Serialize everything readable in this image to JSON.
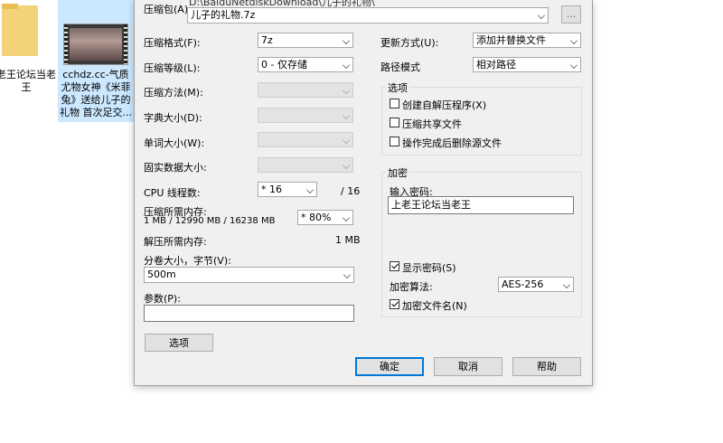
{
  "explorer": {
    "items": [
      {
        "label": "老王论坛当老\n王",
        "icon": "folder-icon"
      },
      {
        "label": "cchdz.cc-气质尤物女神《米菲兔》送给儿子的礼物 首次足交...",
        "icon": "video-thumbnail-icon"
      }
    ]
  },
  "dialog": {
    "archive": {
      "label": "压缩包(A)",
      "path_value": "D:\\BaiduNetdiskDownload\\儿子的礼物\\",
      "name_value": "儿子的礼物.7z",
      "browse_label": "..."
    },
    "left": {
      "format": {
        "label": "压缩格式(F):",
        "value": "7z"
      },
      "level": {
        "label": "压缩等级(L):",
        "value": "0 - 仅存储"
      },
      "method": {
        "label": "压缩方法(M):",
        "value": ""
      },
      "dict": {
        "label": "字典大小(D):",
        "value": ""
      },
      "word": {
        "label": "单词大小(W):",
        "value": ""
      },
      "solid": {
        "label": "固实数据大小:",
        "value": ""
      },
      "threads": {
        "label": "CPU 线程数:",
        "value": "* 16",
        "max": "/ 16"
      },
      "mem_comp": {
        "label": "压缩所需内存:",
        "detail": "1 MB / 12990 MB / 16238 MB",
        "value": "* 80%"
      },
      "mem_decomp": {
        "label": "解压所需内存:",
        "value": "1 MB"
      },
      "volume": {
        "label": "分卷大小，字节(V):",
        "value": "500m"
      },
      "params": {
        "label": "参数(P):",
        "value": ""
      },
      "options_button": "选项"
    },
    "right": {
      "update_mode": {
        "label": "更新方式(U):",
        "value": "添加并替换文件"
      },
      "path_mode": {
        "label": "路径模式",
        "value": "相对路径"
      },
      "options_group": {
        "title": "选项",
        "sfx": {
          "label": "创建自解压程序(X)",
          "checked": false
        },
        "shared": {
          "label": "压缩共享文件",
          "checked": false
        },
        "delete": {
          "label": "操作完成后删除源文件",
          "checked": false
        }
      },
      "encryption_group": {
        "title": "加密",
        "password_label": "输入密码:",
        "password_value": "上老王论坛当老王",
        "show_password": {
          "label": "显示密码(S)",
          "checked": true
        },
        "method_label": "加密算法:",
        "method_value": "AES-256",
        "encrypt_names": {
          "label": "加密文件名(N)",
          "checked": true
        }
      }
    },
    "buttons": {
      "ok": "确定",
      "cancel": "取消",
      "help": "帮助"
    }
  }
}
